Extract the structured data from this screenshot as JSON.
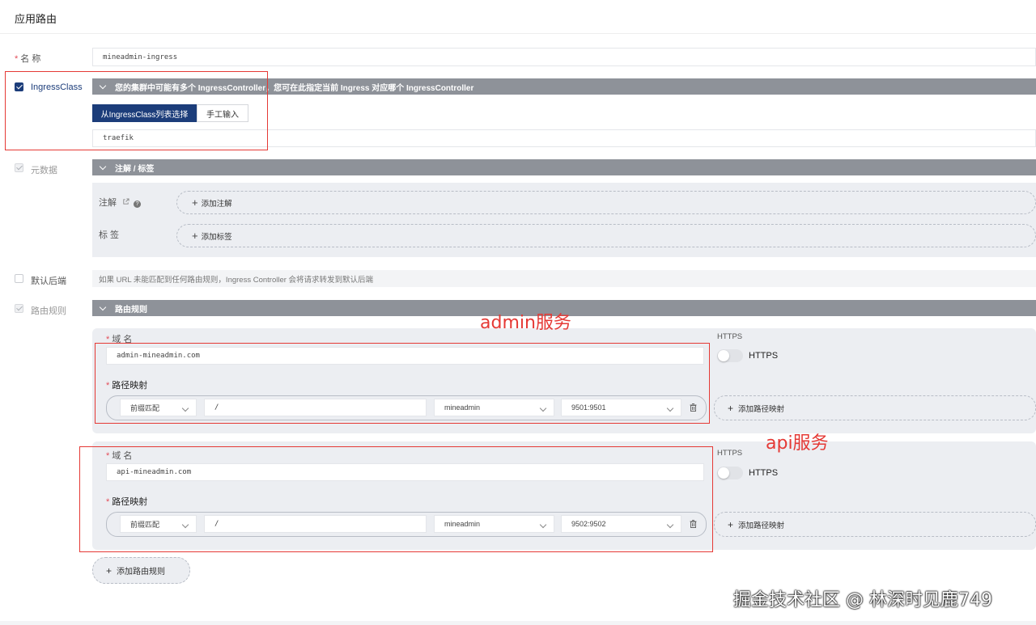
{
  "page": {
    "title": "应用路由"
  },
  "name_field": {
    "label": "名 称",
    "value": "mineadmin-ingress"
  },
  "ingress_class": {
    "label": "IngressClass",
    "checked": true,
    "bar_text": "您的集群中可能有多个 IngressController，您可在此指定当前 Ingress 对应哪个 IngressController",
    "tab_from_list": "从IngressClass列表选择",
    "tab_manual": "手工输入",
    "value": "traefik"
  },
  "metadata": {
    "label": "元数据",
    "bar_text": "注解 / 标签",
    "annotation_label": "注解",
    "add_annotation": "添加注解",
    "labels_label": "标 签",
    "add_label": "添加标签"
  },
  "default_backend": {
    "label": "默认后端",
    "hint": "如果 URL 未能匹配到任何路由规则，Ingress Controller 会将请求转发到默认后端"
  },
  "routing": {
    "label": "路由规则",
    "bar_text": "路由规则",
    "rules": [
      {
        "domain_label": "域 名",
        "domain": "admin-mineadmin.com",
        "https_header": "HTTPS",
        "https_toggle_label": "HTTPS",
        "path_label": "路径映射",
        "match_type": "前缀匹配",
        "path": "/",
        "service": "mineadmin",
        "port": "9501:9501",
        "add_path": "添加路径映射"
      },
      {
        "domain_label": "域 名",
        "domain": "api-mineadmin.com",
        "https_header": "HTTPS",
        "https_toggle_label": "HTTPS",
        "path_label": "路径映射",
        "match_type": "前缀匹配",
        "path": "/",
        "service": "mineadmin",
        "port": "9502:9502",
        "add_path": "添加路径映射"
      }
    ],
    "add_rule": "添加路由规则"
  },
  "annotations": {
    "admin": "admin服务",
    "api": "api服务"
  },
  "watermark": "掘金技术社区 @ 林深时见鹿749",
  "colors": {
    "primary": "#1c3d7a",
    "bar": "#8e9299",
    "annotation_red": "#e53935"
  }
}
